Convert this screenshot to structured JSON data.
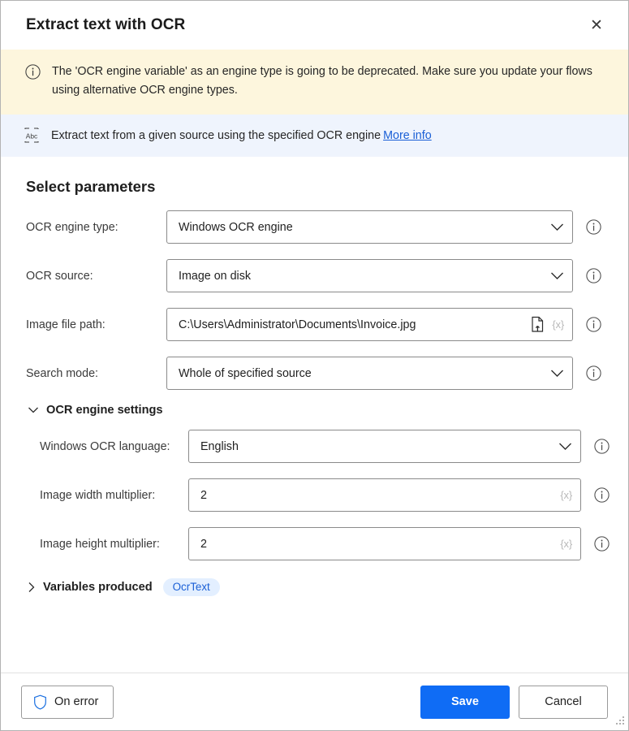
{
  "dialog": {
    "title": "Extract text with OCR",
    "close_label": "✕"
  },
  "warning": {
    "icon": "info-circle-icon",
    "text": "The 'OCR engine variable' as an engine type is going to be deprecated.  Make sure you update your flows using alternative OCR engine types."
  },
  "description": {
    "icon": "ocr-abc-icon",
    "text": "Extract text from a given source using the specified OCR engine",
    "link_label": "More info"
  },
  "main": {
    "section_heading": "Select parameters",
    "fields": [
      {
        "label": "OCR engine type:",
        "value": "Windows OCR engine",
        "type": "dropdown"
      },
      {
        "label": "OCR source:",
        "value": "Image on disk",
        "type": "dropdown"
      },
      {
        "label": "Image file path:",
        "value": "C:\\Users\\Administrator\\Documents\\Invoice.jpg",
        "type": "file",
        "var_token": "{x}"
      },
      {
        "label": "Search mode:",
        "value": "Whole of specified source",
        "type": "dropdown"
      }
    ],
    "engine_settings": {
      "label": "OCR engine settings",
      "expanded": true,
      "fields": [
        {
          "label": "Windows OCR language:",
          "value": "English",
          "type": "dropdown"
        },
        {
          "label": "Image width multiplier:",
          "value": "2",
          "type": "text",
          "var_token": "{x}"
        },
        {
          "label": "Image height multiplier:",
          "value": "2",
          "type": "text",
          "var_token": "{x}"
        }
      ]
    },
    "variables_produced": {
      "label": "Variables produced",
      "expanded": false,
      "pill": "OcrText"
    }
  },
  "footer": {
    "on_error_label": "On error",
    "save_label": "Save",
    "cancel_label": "Cancel"
  },
  "colors": {
    "accent_blue": "#0f6cf5",
    "link_blue": "#1a5fd6",
    "warning_bg": "#fdf6dd",
    "info_bg": "#eff4fd",
    "pill_bg": "#e3efff"
  }
}
